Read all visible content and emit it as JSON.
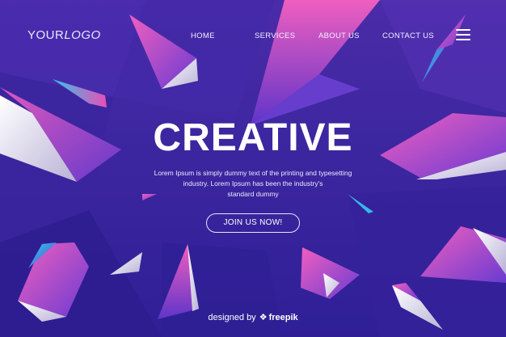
{
  "header": {
    "logo_part1": "YOUR",
    "logo_part2": "LOGO",
    "nav": [
      {
        "label": "HOME"
      },
      {
        "label": "SERVICES"
      },
      {
        "label": "ABOUT US"
      },
      {
        "label": "CONTACT US"
      }
    ],
    "menu_icon": "hamburger-icon"
  },
  "hero": {
    "title": "CREATIVE",
    "text_line1": "Lorem Ipsum is simply dummy text of the printing and typesetting",
    "text_line2": "industry. Lorem Ipsum has been the industry's",
    "text_line3": "standard dummy",
    "cta_label": "JOIN US NOW!"
  },
  "footer": {
    "credit_prefix": "designed by",
    "credit_brand": "freepik",
    "credit_icon": "freepik-icon"
  },
  "colors": {
    "background": "#3d27a0",
    "accent_pink": "#e84fb6",
    "accent_cyan": "#30c6e8"
  }
}
